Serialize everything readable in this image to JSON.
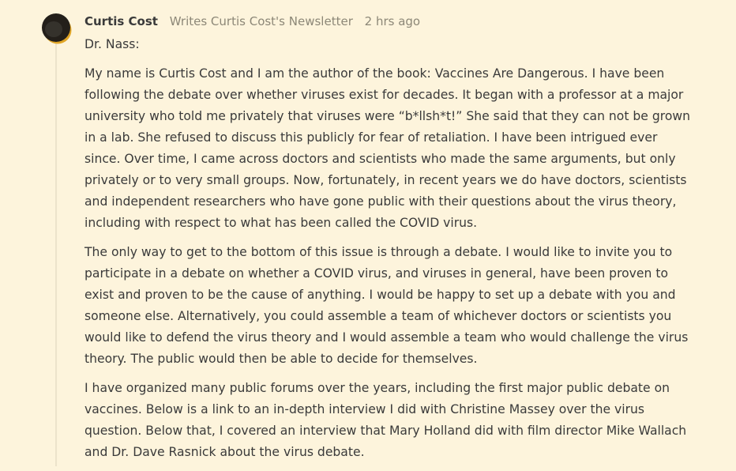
{
  "comment": {
    "author": "Curtis Cost",
    "author_meta": "Writes Curtis Cost's Newsletter",
    "timestamp": "2 hrs ago",
    "greeting": "Dr. Nass:",
    "paragraphs": [
      "My name is Curtis Cost and I am the author of the book: Vaccines Are Dangerous. I have been following the debate over whether viruses exist for decades. It began with a professor at a major university who told me privately that viruses were “b*llsh*t!” She said that they can not be grown in a lab. She refused to discuss this publicly for fear of retaliation. I have been intrigued ever since. Over time, I came across doctors and scientists who made the same arguments, but only privately or to very small groups. Now, fortunately, in recent years we do have doctors, scientists and independent researchers who have gone public with their questions about the virus theory, including with respect to what has been called the COVID virus.",
      "The only way to get to the bottom of this issue is through a debate. I would like to invite you to participate in a debate on whether a COVID virus, and viruses in general, have been proven to exist and proven to be the cause of anything. I would be happy to set up a debate with you and someone else. Alternatively, you could assemble a team of whichever doctors or scientists you would like to defend the virus theory and I would assemble a team who would challenge the virus theory. The public would then be able to decide for themselves.",
      "I have organized many public forums over the years, including the first major public debate on vaccines. Below is a link to an in-depth interview I did with Christine Massey over the virus question. Below that, I covered an interview that Mary Holland did with film director Mike Wallach and Dr. Dave Rasnick about the virus debate."
    ]
  },
  "colors": {
    "background": "#fdf4dc",
    "text": "#3a3a3a",
    "meta": "#8c8777",
    "avatar_accent": "#e0a526"
  }
}
